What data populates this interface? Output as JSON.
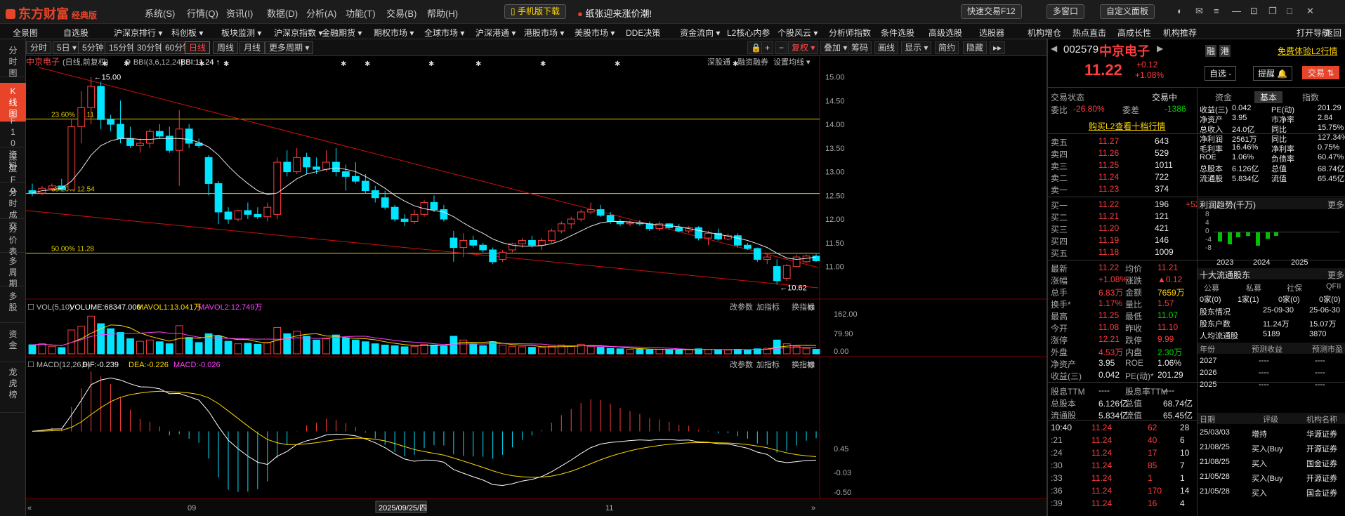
{
  "app": {
    "logo": "东方财富",
    "edition": "经典版"
  },
  "menu": [
    "系统(S)",
    "行情(Q)",
    "资讯(I)",
    "数据(D)",
    "分析(A)",
    "功能(T)",
    "交易(B)",
    "帮助(H)"
  ],
  "title_buttons": {
    "mobile": "手机版下载",
    "promo": "纸张迎来涨价潮!",
    "quick_trade": "快速交易F12",
    "multi_window": "多窗口",
    "custom_panel": "自定义面板"
  },
  "nav": [
    "全景图",
    "自选股",
    "沪深京排行 ▾",
    "科创板 ▾",
    "板块监测 ▾",
    "沪深京指数 ▾",
    "金融期货 ▾",
    "期权市场 ▾",
    "全球市场 ▾",
    "沪深港通 ▾",
    "港股市场 ▾",
    "美股市场 ▾",
    "DDE决策",
    "资金流向 ▾",
    "L2核心内参",
    "个股风云 ▾",
    "分析师指数",
    "条件选股",
    "高级选股",
    "选股器",
    "机构增仓",
    "热点直击",
    "高成长性",
    "机构推荐",
    "打开导航",
    "返回"
  ],
  "left_tabs": [
    "分时图",
    "K线图",
    "F10资料",
    "深度F9",
    "分时成交",
    "分价表",
    "多周期",
    "多股",
    "资金",
    "龙虎榜"
  ],
  "periods": [
    "分时",
    "5日 ▾",
    "5分钟",
    "15分钟",
    "30分钟",
    "60分钟",
    "日线",
    "周线",
    "月线",
    "更多周期 ▾"
  ],
  "active_period": "日线",
  "toolbar_right": [
    "复权 ▾",
    "叠加 ▾",
    "筹码",
    "画线",
    "显示 ▾",
    "简约",
    "隐藏"
  ],
  "chart_header": {
    "stock": "中京电子",
    "mode": "(日线,前复权)",
    "indicator": "BBI(3,6,12,24)",
    "bbi": "BBI:11.24 ↑",
    "links": [
      "深股通",
      "融资融券",
      "设置均线 ▾"
    ]
  },
  "price_axis": [
    "15.00",
    "14.50",
    "14.00",
    "13.50",
    "13.00",
    "12.50",
    "12.00",
    "11.50",
    "11.00"
  ],
  "fib_lines": [
    {
      "label": "23.60% 14.11",
      "price": 14.11
    },
    {
      "label": "38.20% 12.54",
      "price": 12.54
    },
    {
      "label": "50.00% 11.28",
      "price": 11.28
    }
  ],
  "markers": {
    "high": "15.00",
    "low": "10.62"
  },
  "volume_panel": {
    "title": "VOL(5,10)",
    "volume": "VOLUME:68347.000",
    "mavol1": "MAVOL1:13.041万",
    "mavol2": "MAVOL2:12.749万",
    "axis": [
      "162.00",
      "79.90",
      "0.00"
    ],
    "links": [
      "改参数",
      "加指标",
      "换指标"
    ]
  },
  "macd_panel": {
    "title": "MACD(12,26,9)",
    "dif": "DIF:-0.239",
    "dea": "DEA:-0.226",
    "macd": "MACD:-0.026",
    "axis": [
      "0.45",
      "-0.03",
      "-0.50"
    ],
    "links": [
      "改参数",
      "加指标",
      "换指标"
    ]
  },
  "x_axis": {
    "left": "09",
    "mid": "2025/09/25/四",
    "right": "11"
  },
  "quote": {
    "code": "002579",
    "name": "中京电子",
    "price": "11.22",
    "change": "+0.12",
    "pct": "+1.08%",
    "rong": "融",
    "gang": "港",
    "free_l2": "免费体验L2行情",
    "zixuan": "自选 -",
    "tixing": "提醒",
    "jiaoyi": "交易"
  },
  "status": {
    "label": "交易状态",
    "value": "交易中",
    "weibi_label": "委比",
    "weibi": "-26.80%",
    "weicha_label": "委差",
    "weicha": "-1386",
    "l2_link": "购买L2查看十档行情"
  },
  "asks": [
    [
      "卖五",
      "11.27",
      "643"
    ],
    [
      "卖四",
      "11.26",
      "529"
    ],
    [
      "卖三",
      "11.25",
      "1011"
    ],
    [
      "卖二",
      "11.24",
      "722"
    ],
    [
      "卖一",
      "11.23",
      "374"
    ]
  ],
  "bids": [
    [
      "买一",
      "11.22",
      "196",
      "+52"
    ],
    [
      "买二",
      "11.21",
      "121",
      ""
    ],
    [
      "买三",
      "11.20",
      "421",
      ""
    ],
    [
      "买四",
      "11.19",
      "146",
      ""
    ],
    [
      "买五",
      "11.18",
      "1009",
      ""
    ]
  ],
  "stats": [
    [
      "最新",
      "11.22",
      "均价",
      "11.21"
    ],
    [
      "涨幅",
      "+1.08%",
      "涨跌",
      "▲0.12"
    ],
    [
      "总手",
      "6.83万",
      "金额",
      "7659万"
    ],
    [
      "换手*",
      "1.17%",
      "量比",
      "1.57"
    ],
    [
      "最高",
      "11.25",
      "最低",
      "11.07"
    ],
    [
      "今开",
      "11.08",
      "昨收",
      "11.10"
    ],
    [
      "涨停",
      "12.21",
      "跌停",
      "9.99"
    ],
    [
      "外盘",
      "4.53万",
      "内盘",
      "2.30万"
    ],
    [
      "净资产",
      "3.95",
      "ROE",
      "1.06%"
    ],
    [
      "收益(三)",
      "0.042",
      "PE(动)*",
      "201.29"
    ]
  ],
  "stats2": [
    [
      "股息TTM",
      "----",
      "股息率TTM",
      "----"
    ],
    [
      "总股本",
      "6.126亿",
      "总值",
      "68.74亿"
    ],
    [
      "流通股",
      "5.834亿",
      "流值",
      "65.45亿"
    ]
  ],
  "ticks": [
    [
      "10:40",
      "11.24",
      "62",
      "28"
    ],
    [
      ":21",
      "11.24",
      "40",
      "6"
    ],
    [
      ":24",
      "11.24",
      "17",
      "10"
    ],
    [
      ":30",
      "11.24",
      "85",
      "7"
    ],
    [
      ":33",
      "11.24",
      "1",
      "1"
    ],
    [
      ":36",
      "11.24",
      "170",
      "14"
    ],
    [
      ":39",
      "11.24",
      "16",
      "4"
    ]
  ],
  "fund_tabs": [
    "资金",
    "基本",
    "指数"
  ],
  "fund": [
    [
      "收益(三)",
      "0.042",
      "PE(动)",
      "201.29"
    ],
    [
      "净资产",
      "3.95",
      "市净率",
      "2.84"
    ],
    [
      "总收入",
      "24.0亿",
      "同比",
      "15.75%"
    ],
    [
      "净利润",
      "2561万",
      "同比",
      "127.34%"
    ],
    [
      "毛利率",
      "16.46%",
      "净利率",
      "0.75%"
    ],
    [
      "ROE",
      "1.06%",
      "负债率",
      "60.47%"
    ],
    [
      "总股本",
      "6.126亿",
      "总值",
      "68.74亿"
    ],
    [
      "流通股",
      "5.834亿",
      "流值",
      "65.45亿"
    ]
  ],
  "profit_trend": {
    "title": "利润趋势(千万)",
    "more": "更多",
    "yaxis": [
      "8",
      "4",
      "0",
      "-4",
      "-8"
    ],
    "years": [
      "2023",
      "2024",
      "2025"
    ]
  },
  "top10": {
    "title": "十大流通股东",
    "more": "更多",
    "heads": [
      "公募",
      "私募",
      "社保",
      "QFII"
    ],
    "vals": [
      "0家(0)",
      "1家(1)",
      "0家(0)",
      "0家(0)"
    ],
    "rows": [
      [
        "股东情况",
        "25-09-30",
        "25-06-30"
      ],
      [
        "股东户数",
        "11.24万",
        "15.07万"
      ],
      [
        "人均流通股",
        "5189",
        "3870"
      ]
    ]
  },
  "forecast": {
    "heads": [
      "年份",
      "预测收益",
      "预测市盈"
    ],
    "rows": [
      [
        "2027",
        "----",
        "----"
      ],
      [
        "2026",
        "----",
        "----"
      ],
      [
        "2025",
        "----",
        "----"
      ]
    ]
  },
  "ratings": {
    "heads": [
      "日期",
      "评级",
      "机构名称"
    ],
    "rows": [
      [
        "25/03/03",
        "增持",
        "华源证券"
      ],
      [
        "21/08/25",
        "买入(Buy",
        "开源证券"
      ],
      [
        "21/08/25",
        "买入",
        "国金证券"
      ],
      [
        "21/05/28",
        "买入(Buy",
        "开源证券"
      ],
      [
        "21/05/28",
        "买入",
        "国金证券"
      ]
    ]
  },
  "chart_data": {
    "type": "candlestick",
    "price_range": [
      10.55,
      15.2
    ],
    "candles": [
      [
        12.6,
        12.75,
        12.48,
        12.55
      ],
      [
        12.55,
        12.7,
        12.5,
        12.65
      ],
      [
        12.65,
        12.75,
        12.6,
        12.7
      ],
      [
        12.7,
        12.85,
        12.6,
        12.62
      ],
      [
        12.62,
        14.1,
        12.6,
        13.95
      ],
      [
        13.95,
        14.7,
        13.6,
        14.35
      ],
      [
        14.35,
        15.0,
        14.0,
        14.8
      ],
      [
        14.8,
        14.9,
        13.9,
        14.1
      ],
      [
        14.1,
        14.2,
        13.85,
        14.0
      ],
      [
        14.0,
        14.5,
        13.6,
        13.7
      ],
      [
        13.7,
        13.95,
        13.5,
        13.55
      ],
      [
        13.55,
        13.7,
        13.4,
        13.6
      ],
      [
        13.6,
        13.9,
        13.5,
        13.85
      ],
      [
        13.85,
        14.0,
        13.7,
        13.75
      ],
      [
        13.75,
        13.95,
        13.4,
        13.45
      ],
      [
        13.45,
        14.3,
        12.7,
        13.9
      ],
      [
        13.9,
        14.0,
        13.5,
        13.6
      ],
      [
        13.6,
        13.7,
        13.5,
        13.55
      ],
      [
        13.3,
        13.35,
        12.5,
        12.75
      ],
      [
        12.75,
        12.8,
        11.9,
        12.15
      ],
      [
        12.15,
        12.25,
        11.9,
        12.0
      ],
      [
        12.0,
        12.2,
        11.95,
        12.18
      ],
      [
        12.18,
        12.35,
        12.0,
        12.1
      ],
      [
        12.1,
        12.25,
        12.0,
        12.05
      ],
      [
        12.05,
        12.35,
        11.95,
        12.25
      ],
      [
        12.1,
        13.3,
        12.0,
        13.2
      ],
      [
        13.2,
        13.45,
        12.9,
        13.0
      ],
      [
        13.0,
        13.5,
        12.95,
        13.3
      ],
      [
        13.3,
        13.4,
        12.95,
        13.1
      ],
      [
        13.1,
        13.3,
        12.95,
        13.05
      ],
      [
        13.05,
        13.45,
        13.0,
        13.2
      ],
      [
        13.2,
        13.5,
        12.9,
        13.0
      ],
      [
        13.0,
        13.15,
        12.6,
        12.9
      ],
      [
        12.9,
        13.2,
        12.75,
        12.8
      ],
      [
        12.8,
        12.95,
        12.55,
        12.6
      ],
      [
        12.6,
        12.7,
        12.35,
        12.45
      ],
      [
        12.45,
        12.6,
        12.2,
        12.25
      ],
      [
        12.25,
        12.3,
        11.95,
        12.0
      ],
      [
        12.0,
        12.1,
        11.85,
        11.95
      ],
      [
        11.95,
        12.2,
        11.9,
        12.1
      ],
      [
        12.1,
        12.4,
        12.05,
        12.35
      ],
      [
        12.35,
        12.5,
        12.15,
        12.2
      ],
      [
        12.2,
        12.3,
        11.95,
        12.0
      ],
      [
        11.6,
        11.75,
        11.1,
        11.4
      ],
      [
        11.4,
        11.7,
        11.2,
        11.55
      ],
      [
        11.55,
        11.65,
        11.4,
        11.45
      ],
      [
        11.45,
        11.5,
        11.3,
        11.35
      ],
      [
        11.35,
        11.4,
        11.05,
        11.1
      ],
      [
        11.15,
        11.35,
        11.1,
        11.3
      ],
      [
        11.35,
        11.5,
        11.3,
        11.48
      ],
      [
        11.48,
        11.6,
        11.4,
        11.55
      ],
      [
        11.55,
        11.65,
        11.4,
        11.45
      ],
      [
        11.45,
        11.6,
        11.35,
        11.55
      ],
      [
        11.55,
        11.8,
        11.5,
        11.75
      ],
      [
        11.75,
        11.95,
        11.7,
        11.9
      ],
      [
        11.9,
        12.05,
        11.8,
        12.0
      ],
      [
        12.0,
        12.2,
        11.95,
        12.15
      ],
      [
        12.15,
        12.35,
        12.1,
        12.2
      ],
      [
        12.2,
        12.3,
        12.05,
        12.08
      ],
      [
        12.08,
        12.15,
        11.9,
        11.95
      ],
      [
        11.95,
        12.0,
        11.85,
        11.9
      ],
      [
        11.9,
        11.97,
        11.85,
        11.92
      ],
      [
        11.92,
        11.98,
        11.86,
        11.9
      ],
      [
        11.9,
        11.95,
        11.75,
        11.8
      ],
      [
        11.8,
        11.95,
        11.75,
        11.9
      ],
      [
        11.9,
        11.92,
        11.78,
        11.82
      ],
      [
        11.82,
        11.9,
        11.72,
        11.75
      ],
      [
        11.75,
        11.85,
        11.7,
        11.82
      ],
      [
        11.82,
        11.85,
        11.55,
        11.6
      ],
      [
        11.6,
        11.75,
        11.45,
        11.7
      ],
      [
        11.7,
        11.8,
        11.55,
        11.58
      ],
      [
        11.58,
        11.7,
        11.55,
        11.65
      ],
      [
        11.65,
        11.7,
        11.4,
        11.45
      ],
      [
        11.45,
        11.5,
        11.35,
        11.38
      ],
      [
        11.38,
        11.4,
        11.1,
        11.15
      ],
      [
        11.15,
        11.25,
        11.05,
        11.2
      ],
      [
        11.0,
        11.15,
        10.62,
        10.7
      ],
      [
        10.75,
        11.05,
        10.7,
        11.02
      ],
      [
        11.0,
        11.25,
        10.98,
        11.2
      ],
      [
        11.1,
        11.25,
        11.07,
        11.22
      ],
      [
        11.22,
        11.26,
        11.1,
        11.12
      ]
    ],
    "bbi": [
      12.55,
      12.6,
      12.62,
      12.65,
      12.8,
      13.05,
      13.35,
      13.55,
      13.65,
      13.7,
      13.7,
      13.68,
      13.68,
      13.7,
      13.7,
      13.7,
      13.68,
      13.62,
      13.52,
      13.35,
      13.12,
      12.92,
      12.75,
      12.6,
      12.52,
      12.55,
      12.7,
      12.85,
      12.95,
      13.0,
      13.05,
      13.08,
      13.05,
      13.0,
      12.9,
      12.78,
      12.65,
      12.5,
      12.38,
      12.28,
      12.22,
      12.18,
      12.15,
      12.05,
      11.92,
      11.8,
      11.7,
      11.58,
      11.5,
      11.45,
      11.43,
      11.43,
      11.44,
      11.48,
      11.55,
      11.65,
      11.75,
      11.85,
      11.92,
      11.95,
      11.95,
      11.94,
      11.92,
      11.9,
      11.88,
      11.86,
      11.84,
      11.8,
      11.76,
      11.72,
      11.68,
      11.64,
      11.6,
      11.55,
      11.48,
      11.4,
      11.28,
      11.18,
      11.15,
      11.17,
      11.2
    ],
    "volume_range": [
      0,
      162
    ],
    "volume": [
      36,
      40,
      30,
      25,
      95,
      110,
      150,
      120,
      100,
      85,
      60,
      50,
      55,
      48,
      40,
      112,
      65,
      45,
      80,
      70,
      50,
      40,
      42,
      38,
      45,
      105,
      80,
      90,
      70,
      55,
      60,
      75,
      62,
      55,
      48,
      40,
      35,
      32,
      28,
      30,
      38,
      35,
      30,
      70,
      55,
      40,
      32,
      48,
      35,
      30,
      28,
      26,
      24,
      30,
      35,
      32,
      38,
      30,
      26,
      22,
      20,
      18,
      18,
      16,
      18,
      16,
      15,
      17,
      20,
      18,
      16,
      15,
      18,
      16,
      20,
      22,
      55,
      40,
      30,
      22,
      18
    ],
    "macd_range": [
      -0.5,
      0.45
    ]
  }
}
